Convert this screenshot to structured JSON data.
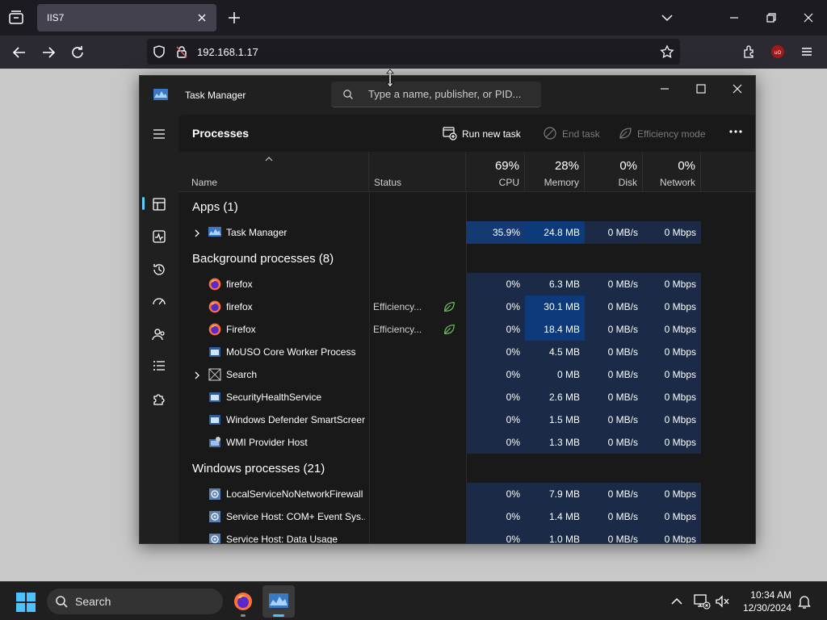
{
  "browser": {
    "tab_title": "IIS7",
    "url": "192.168.1.17"
  },
  "task_manager": {
    "title": "Task Manager",
    "search_placeholder": "Type a name, publisher, or PID...",
    "page_title": "Processes",
    "toolbar": {
      "run_new_task": "Run new task",
      "end_task": "End task",
      "efficiency_mode": "Efficiency mode"
    },
    "columns": {
      "name": "Name",
      "status": "Status",
      "cpu_pct": "69%",
      "cpu": "CPU",
      "memory_pct": "28%",
      "memory": "Memory",
      "disk_pct": "0%",
      "disk": "Disk",
      "network_pct": "0%",
      "network": "Network"
    },
    "groups": {
      "apps": "Apps (1)",
      "background": "Background processes (8)",
      "windows": "Windows processes (21)"
    },
    "apps": [
      {
        "name": "Task Manager",
        "status": "",
        "cpu": "35.9%",
        "memory": "24.8 MB",
        "disk": "0 MB/s",
        "network": "0 Mbps",
        "icon": "task-manager-icon",
        "expandable": true
      }
    ],
    "background": [
      {
        "name": "firefox",
        "status": "",
        "cpu": "0%",
        "memory": "6.3 MB",
        "disk": "0 MB/s",
        "network": "0 Mbps",
        "icon": "firefox-icon"
      },
      {
        "name": "firefox",
        "status": "Efficiency...",
        "cpu": "0%",
        "memory": "30.1 MB",
        "disk": "0 MB/s",
        "network": "0 Mbps",
        "icon": "firefox-icon"
      },
      {
        "name": "Firefox",
        "status": "Efficiency...",
        "cpu": "0%",
        "memory": "18.4 MB",
        "disk": "0 MB/s",
        "network": "0 Mbps",
        "icon": "firefox-icon"
      },
      {
        "name": "MoUSO Core Worker Process",
        "status": "",
        "cpu": "0%",
        "memory": "4.5 MB",
        "disk": "0 MB/s",
        "network": "0 Mbps",
        "icon": "window-app-icon"
      },
      {
        "name": "Search",
        "status": "",
        "cpu": "0%",
        "memory": "0 MB",
        "disk": "0 MB/s",
        "network": "0 Mbps",
        "icon": "search-process-icon"
      },
      {
        "name": "SecurityHealthService",
        "status": "",
        "cpu": "0%",
        "memory": "2.6 MB",
        "disk": "0 MB/s",
        "network": "0 Mbps",
        "icon": "window-app-icon"
      },
      {
        "name": "Windows Defender SmartScreen",
        "status": "",
        "cpu": "0%",
        "memory": "1.5 MB",
        "disk": "0 MB/s",
        "network": "0 Mbps",
        "icon": "window-app-icon"
      },
      {
        "name": "WMI Provider Host",
        "status": "",
        "cpu": "0%",
        "memory": "1.3 MB",
        "disk": "0 MB/s",
        "network": "0 Mbps",
        "icon": "wmi-icon"
      }
    ],
    "windows": [
      {
        "name": "LocalServiceNoNetworkFirewall",
        "status": "",
        "cpu": "0%",
        "memory": "7.9 MB",
        "disk": "0 MB/s",
        "network": "0 Mbps",
        "icon": "service-host-icon"
      },
      {
        "name": "Service Host: COM+ Event Sys...",
        "status": "",
        "cpu": "0%",
        "memory": "1.4 MB",
        "disk": "0 MB/s",
        "network": "0 Mbps",
        "icon": "service-host-icon"
      },
      {
        "name": "Service Host: Data Usage",
        "status": "",
        "cpu": "0%",
        "memory": "1.0 MB",
        "disk": "0 MB/s",
        "network": "0 Mbps",
        "icon": "service-host-icon"
      }
    ]
  },
  "taskbar": {
    "search_label": "Search",
    "time": "10:34 AM",
    "date": "12/30/2024"
  },
  "colors": {
    "accent": "#60cdff",
    "cpu_heat_high": "#0d3a7a",
    "heat_low": "#1b2a47",
    "efficiency_leaf": "#6ccb5f"
  }
}
